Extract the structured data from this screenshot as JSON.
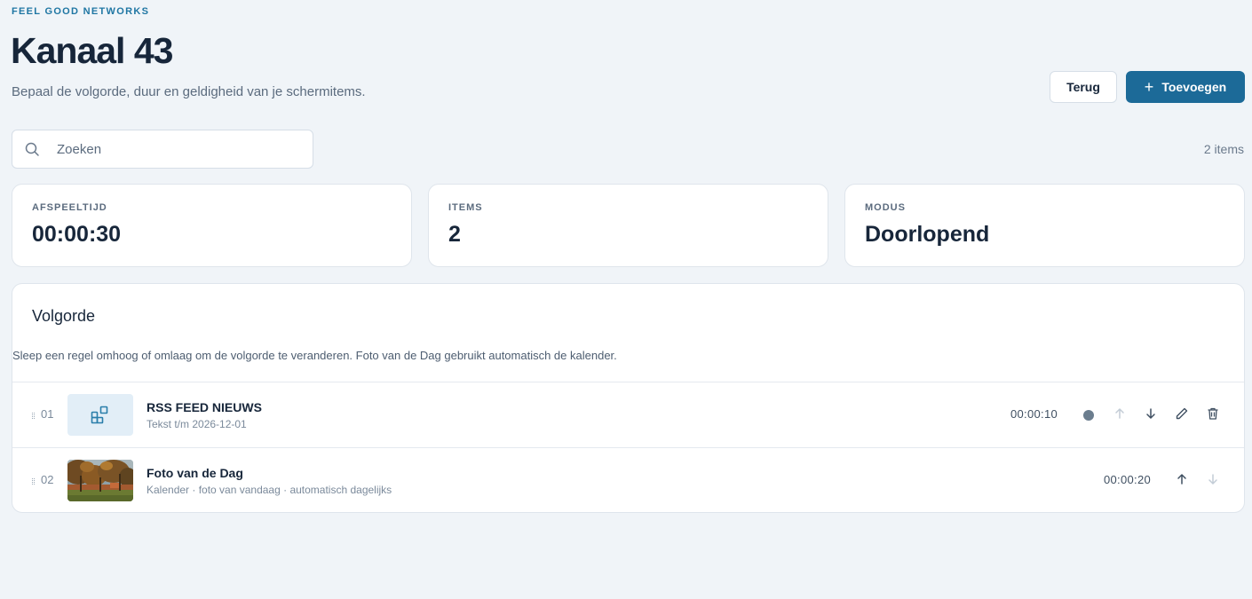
{
  "header": {
    "brand": "FEEL GOOD NETWORKS",
    "title": "Kanaal 43",
    "subtitle": "Bepaal de volgorde, duur en geldigheid van je schermitems."
  },
  "actions": {
    "back_label": "Terug",
    "add_label": "Toevoegen",
    "add_icon": "plus-icon"
  },
  "search": {
    "placeholder": "Zoeken",
    "value": "",
    "icon": "search-icon"
  },
  "item_count": "2 items",
  "stats": [
    {
      "label": "AFSPEELTIJD",
      "value": "00:00:30"
    },
    {
      "label": "ITEMS",
      "value": "2"
    },
    {
      "label": "MODUS",
      "value": "Doorlopend"
    }
  ],
  "playlist": {
    "title": "Volgorde",
    "description": "Sleep een regel omhoog of omlaag om de volgorde te veranderen. Foto van de Dag gebruikt automatisch de kalender.",
    "items": [
      {
        "index": "01",
        "name": "RSS FEED NIEUWS",
        "meta": "Tekst t/m 2026-12-01",
        "duration": "00:00:10",
        "thumbnail": "widgets-icon",
        "actions": [
          "status-dot",
          "move-up-icon",
          "move-down-icon",
          "edit-icon",
          "delete-icon"
        ]
      },
      {
        "index": "02",
        "name": "Foto van de Dag",
        "meta": "Kalender · foto van vandaag · automatisch dagelijks",
        "duration": "00:00:20",
        "thumbnail": "photo-autumn-trees",
        "actions": [
          "move-up-icon",
          "move-down-icon"
        ]
      }
    ]
  },
  "colors": {
    "background": "#f0f4f8",
    "brand": "#1f76a3",
    "primary_button": "#1c6a98",
    "title": "#17263a"
  }
}
